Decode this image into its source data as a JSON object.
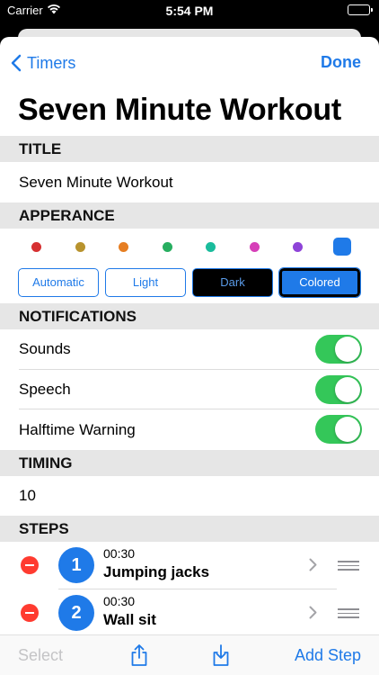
{
  "status_bar": {
    "carrier": "Carrier",
    "time": "5:54 PM"
  },
  "nav": {
    "back_label": "Timers",
    "done_label": "Done"
  },
  "page_title": "Seven Minute Workout",
  "sections": {
    "title": {
      "header": "TITLE",
      "value": "Seven Minute Workout"
    },
    "appearance": {
      "header": "APPERANCE",
      "colors": [
        "#d63031",
        "#b8932e",
        "#e67e22",
        "#27ae60",
        "#1abc9c",
        "#d63fb8",
        "#8e44d8",
        "#1f7ae8"
      ],
      "selected_color": "#1f7ae8",
      "themes": [
        "Automatic",
        "Light",
        "Dark",
        "Colored"
      ],
      "selected_theme": "Colored"
    },
    "notifications": {
      "header": "NOTIFICATIONS",
      "items": [
        {
          "label": "Sounds",
          "on": true
        },
        {
          "label": "Speech",
          "on": true
        },
        {
          "label": "Halftime Warning",
          "on": true
        }
      ]
    },
    "timing": {
      "header": "TIMING",
      "value": "10"
    },
    "steps": {
      "header": "STEPS",
      "items": [
        {
          "number": "1",
          "duration": "00:30",
          "name": "Jumping jacks"
        },
        {
          "number": "2",
          "duration": "00:30",
          "name": "Wall sit"
        }
      ]
    }
  },
  "toolbar": {
    "select_label": "Select",
    "add_step_label": "Add Step"
  }
}
